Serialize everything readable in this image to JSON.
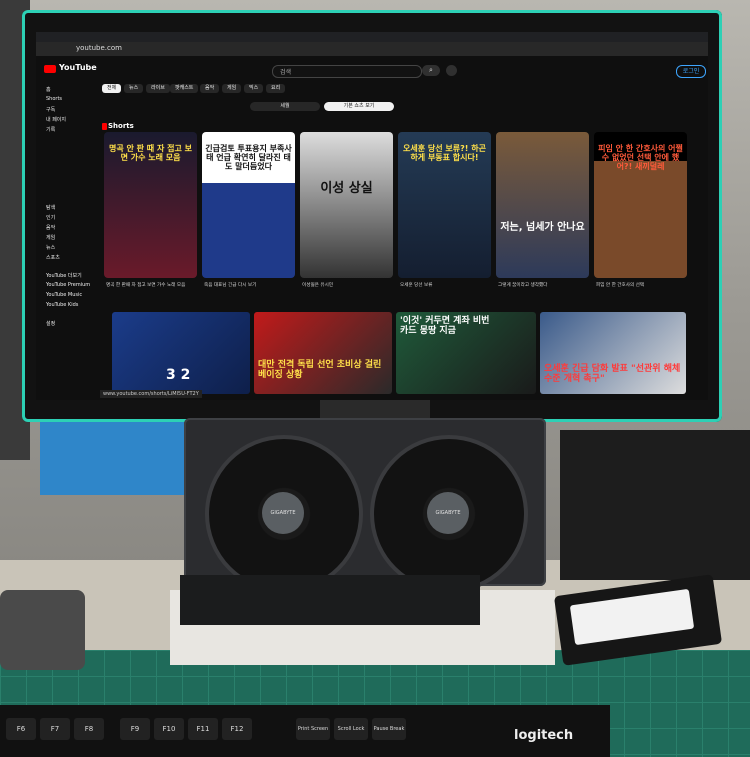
{
  "browser": {
    "url": "youtube.com",
    "search_placeholder": "검색",
    "login_label": "로그인",
    "status_url": "www.youtube.com/shorts/LiMI5U-FT2Y"
  },
  "logo": "YouTube",
  "chips": [
    {
      "label": "전체",
      "selected": true
    },
    {
      "label": "뉴스"
    },
    {
      "label": "라이브"
    },
    {
      "label": "팟캐스트"
    },
    {
      "label": "음악"
    },
    {
      "label": "게임"
    },
    {
      "label": "믹스"
    },
    {
      "label": "요리"
    }
  ],
  "toggles": [
    "세월",
    "기본 쇼츠 보기"
  ],
  "sidebar": {
    "items": [
      "홈",
      "Shorts",
      "구독",
      "내 페이지",
      "기록"
    ],
    "sections": [
      "탐색",
      "인기",
      "음악",
      "게임",
      "뉴스",
      "스포츠"
    ],
    "more": [
      "YouTube 더보기",
      "YouTube Premium",
      "YouTube Music",
      "YouTube Kids"
    ],
    "settings": "설정"
  },
  "shorts_title": "Shorts",
  "shorts": [
    {
      "caption": "명곡 안 판 때 자 접고 보면 가수 노래 모음",
      "title": "명곡 한 판때 자 접고 보면 가수 노래 모음"
    },
    {
      "caption": "긴급검토 투표용지 부족사태 언급 확연히 달라진 태도 말더듬었다",
      "title": "죽음 대표님 긴급 다시 보기"
    },
    {
      "caption": "이성 상실",
      "title": "이성잃은 유시민"
    },
    {
      "caption": "오세훈 당선 보류?! 하곤하게 부동표 합시다!",
      "title": "오세훈 당선 보류"
    },
    {
      "caption": "저는, 넘세가 안나요",
      "title": "그렇게 꿈이라고 생각했다"
    },
    {
      "caption": "피임 안 한 간호사의 어쩔 수 없었던 선택 안에 했어?! 새끼덜레",
      "title": "피임 안 한 간호사의 선택"
    }
  ],
  "row2": [
    {
      "caption": "3 2"
    },
    {
      "caption": "대만 전격 독립 선언 초비상 걸린 베이징 상황"
    },
    {
      "caption": "'이것' 커두면 계좌 비번 카드 몽땅 지금"
    },
    {
      "caption": "오세훈 긴급 담화 발표 \"선관위 해체 수준 개혁 촉구\""
    }
  ],
  "hardware": {
    "gpu_brand": "GIGABYTE",
    "keyboard_brand": "logitech",
    "keys": [
      "F6",
      "F7",
      "F8",
      "F9",
      "F10",
      "F11",
      "F12",
      "Print Screen",
      "Scroll Lock",
      "Pause Break"
    ]
  },
  "colors": {
    "accent": "#2dd0b5",
    "yt_red": "#ff0000",
    "caption_yellow": "#ffe04a"
  }
}
